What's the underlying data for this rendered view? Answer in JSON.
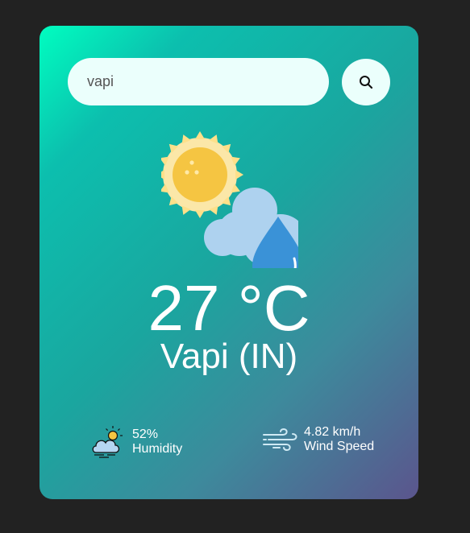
{
  "search": {
    "value": "vapi"
  },
  "weather": {
    "temperature": "27 °C",
    "city": "Vapi (IN)",
    "icon": "sun-cloud-rain-icon"
  },
  "details": {
    "humidity_value": "52%",
    "humidity_label": "Humidity",
    "wind_value": "4.82 km/h",
    "wind_label": "Wind Speed"
  },
  "colors": {
    "page_background": "#222222",
    "card_gradient": [
      "#00fec0",
      "#1aa69f",
      "#5b558d"
    ],
    "input_background": "#ebfffc"
  }
}
